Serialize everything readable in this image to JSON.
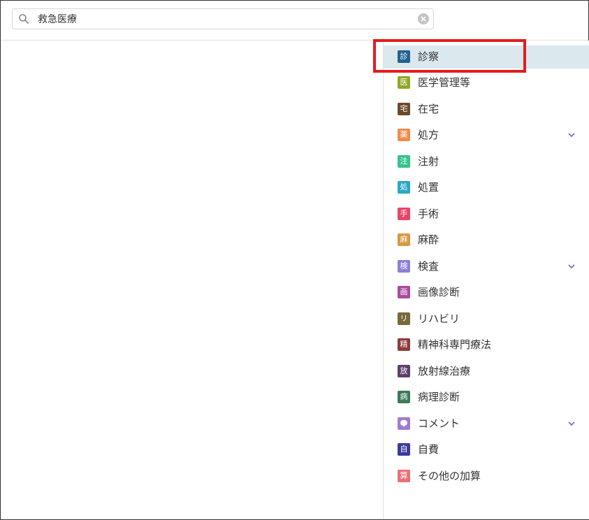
{
  "search": {
    "value": "救急医療",
    "placeholder": ""
  },
  "sidebar": {
    "items": [
      {
        "badge": "診",
        "label": "診察",
        "color": "#1f6391",
        "active": true,
        "expandable": false
      },
      {
        "badge": "医",
        "label": "医学管理等",
        "color": "#8ea823",
        "active": false,
        "expandable": false
      },
      {
        "badge": "宅",
        "label": "在宅",
        "color": "#6b4a2c",
        "active": false,
        "expandable": false
      },
      {
        "badge": "薬",
        "label": "処方",
        "color": "#ef8b4c",
        "active": false,
        "expandable": true
      },
      {
        "badge": "注",
        "label": "注射",
        "color": "#33c48d",
        "active": false,
        "expandable": false
      },
      {
        "badge": "処",
        "label": "処置",
        "color": "#29a7c7",
        "active": false,
        "expandable": false
      },
      {
        "badge": "手",
        "label": "手術",
        "color": "#e8446a",
        "active": false,
        "expandable": false
      },
      {
        "badge": "麻",
        "label": "麻酔",
        "color": "#d69a45",
        "active": false,
        "expandable": false
      },
      {
        "badge": "検",
        "label": "検査",
        "color": "#8c7fd8",
        "active": false,
        "expandable": true
      },
      {
        "badge": "画",
        "label": "画像診断",
        "color": "#a84aa0",
        "active": false,
        "expandable": false
      },
      {
        "badge": "リ",
        "label": "リハビリ",
        "color": "#766a3a",
        "active": false,
        "expandable": false
      },
      {
        "badge": "精",
        "label": "精神科専門療法",
        "color": "#8d3a3a",
        "active": false,
        "expandable": false
      },
      {
        "badge": "放",
        "label": "放射線治療",
        "color": "#5c3f6e",
        "active": false,
        "expandable": false
      },
      {
        "badge": "病",
        "label": "病理診断",
        "color": "#3c7a57",
        "active": false,
        "expandable": false
      },
      {
        "badge": "",
        "label": "コメント",
        "color": "#a27bd0",
        "active": false,
        "expandable": true,
        "icon": "comment-bubble-icon"
      },
      {
        "badge": "自",
        "label": "自費",
        "color": "#3b3a9a",
        "active": false,
        "expandable": false
      },
      {
        "badge": "算",
        "label": "その他の加算",
        "color": "#ea7172",
        "active": false,
        "expandable": false
      }
    ]
  },
  "colors": {
    "highlight": "#e31c1c",
    "active_row": "#dbe8ee",
    "chevron": "#7a6fc9"
  }
}
